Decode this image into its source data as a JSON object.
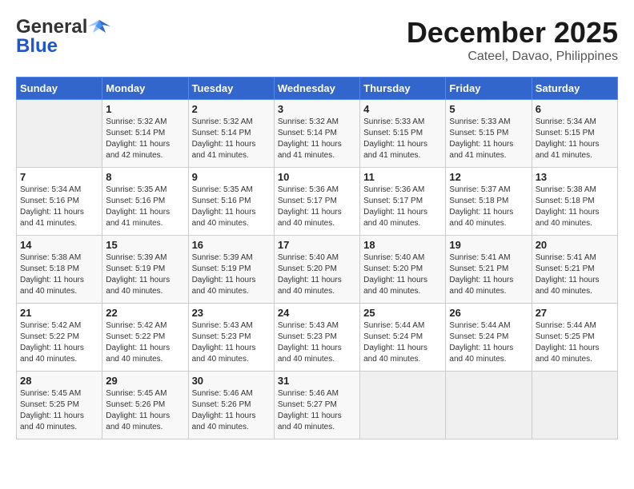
{
  "header": {
    "logo_general": "General",
    "logo_blue": "Blue",
    "month_year": "December 2025",
    "location": "Cateel, Davao, Philippines"
  },
  "weekdays": [
    "Sunday",
    "Monday",
    "Tuesday",
    "Wednesday",
    "Thursday",
    "Friday",
    "Saturday"
  ],
  "weeks": [
    [
      {
        "day": "",
        "sunrise": "",
        "sunset": "",
        "daylight": ""
      },
      {
        "day": "1",
        "sunrise": "Sunrise: 5:32 AM",
        "sunset": "Sunset: 5:14 PM",
        "daylight": "Daylight: 11 hours and 42 minutes."
      },
      {
        "day": "2",
        "sunrise": "Sunrise: 5:32 AM",
        "sunset": "Sunset: 5:14 PM",
        "daylight": "Daylight: 11 hours and 41 minutes."
      },
      {
        "day": "3",
        "sunrise": "Sunrise: 5:32 AM",
        "sunset": "Sunset: 5:14 PM",
        "daylight": "Daylight: 11 hours and 41 minutes."
      },
      {
        "day": "4",
        "sunrise": "Sunrise: 5:33 AM",
        "sunset": "Sunset: 5:15 PM",
        "daylight": "Daylight: 11 hours and 41 minutes."
      },
      {
        "day": "5",
        "sunrise": "Sunrise: 5:33 AM",
        "sunset": "Sunset: 5:15 PM",
        "daylight": "Daylight: 11 hours and 41 minutes."
      },
      {
        "day": "6",
        "sunrise": "Sunrise: 5:34 AM",
        "sunset": "Sunset: 5:15 PM",
        "daylight": "Daylight: 11 hours and 41 minutes."
      }
    ],
    [
      {
        "day": "7",
        "sunrise": "Sunrise: 5:34 AM",
        "sunset": "Sunset: 5:16 PM",
        "daylight": "Daylight: 11 hours and 41 minutes."
      },
      {
        "day": "8",
        "sunrise": "Sunrise: 5:35 AM",
        "sunset": "Sunset: 5:16 PM",
        "daylight": "Daylight: 11 hours and 41 minutes."
      },
      {
        "day": "9",
        "sunrise": "Sunrise: 5:35 AM",
        "sunset": "Sunset: 5:16 PM",
        "daylight": "Daylight: 11 hours and 40 minutes."
      },
      {
        "day": "10",
        "sunrise": "Sunrise: 5:36 AM",
        "sunset": "Sunset: 5:17 PM",
        "daylight": "Daylight: 11 hours and 40 minutes."
      },
      {
        "day": "11",
        "sunrise": "Sunrise: 5:36 AM",
        "sunset": "Sunset: 5:17 PM",
        "daylight": "Daylight: 11 hours and 40 minutes."
      },
      {
        "day": "12",
        "sunrise": "Sunrise: 5:37 AM",
        "sunset": "Sunset: 5:18 PM",
        "daylight": "Daylight: 11 hours and 40 minutes."
      },
      {
        "day": "13",
        "sunrise": "Sunrise: 5:38 AM",
        "sunset": "Sunset: 5:18 PM",
        "daylight": "Daylight: 11 hours and 40 minutes."
      }
    ],
    [
      {
        "day": "14",
        "sunrise": "Sunrise: 5:38 AM",
        "sunset": "Sunset: 5:18 PM",
        "daylight": "Daylight: 11 hours and 40 minutes."
      },
      {
        "day": "15",
        "sunrise": "Sunrise: 5:39 AM",
        "sunset": "Sunset: 5:19 PM",
        "daylight": "Daylight: 11 hours and 40 minutes."
      },
      {
        "day": "16",
        "sunrise": "Sunrise: 5:39 AM",
        "sunset": "Sunset: 5:19 PM",
        "daylight": "Daylight: 11 hours and 40 minutes."
      },
      {
        "day": "17",
        "sunrise": "Sunrise: 5:40 AM",
        "sunset": "Sunset: 5:20 PM",
        "daylight": "Daylight: 11 hours and 40 minutes."
      },
      {
        "day": "18",
        "sunrise": "Sunrise: 5:40 AM",
        "sunset": "Sunset: 5:20 PM",
        "daylight": "Daylight: 11 hours and 40 minutes."
      },
      {
        "day": "19",
        "sunrise": "Sunrise: 5:41 AM",
        "sunset": "Sunset: 5:21 PM",
        "daylight": "Daylight: 11 hours and 40 minutes."
      },
      {
        "day": "20",
        "sunrise": "Sunrise: 5:41 AM",
        "sunset": "Sunset: 5:21 PM",
        "daylight": "Daylight: 11 hours and 40 minutes."
      }
    ],
    [
      {
        "day": "21",
        "sunrise": "Sunrise: 5:42 AM",
        "sunset": "Sunset: 5:22 PM",
        "daylight": "Daylight: 11 hours and 40 minutes."
      },
      {
        "day": "22",
        "sunrise": "Sunrise: 5:42 AM",
        "sunset": "Sunset: 5:22 PM",
        "daylight": "Daylight: 11 hours and 40 minutes."
      },
      {
        "day": "23",
        "sunrise": "Sunrise: 5:43 AM",
        "sunset": "Sunset: 5:23 PM",
        "daylight": "Daylight: 11 hours and 40 minutes."
      },
      {
        "day": "24",
        "sunrise": "Sunrise: 5:43 AM",
        "sunset": "Sunset: 5:23 PM",
        "daylight": "Daylight: 11 hours and 40 minutes."
      },
      {
        "day": "25",
        "sunrise": "Sunrise: 5:44 AM",
        "sunset": "Sunset: 5:24 PM",
        "daylight": "Daylight: 11 hours and 40 minutes."
      },
      {
        "day": "26",
        "sunrise": "Sunrise: 5:44 AM",
        "sunset": "Sunset: 5:24 PM",
        "daylight": "Daylight: 11 hours and 40 minutes."
      },
      {
        "day": "27",
        "sunrise": "Sunrise: 5:44 AM",
        "sunset": "Sunset: 5:25 PM",
        "daylight": "Daylight: 11 hours and 40 minutes."
      }
    ],
    [
      {
        "day": "28",
        "sunrise": "Sunrise: 5:45 AM",
        "sunset": "Sunset: 5:25 PM",
        "daylight": "Daylight: 11 hours and 40 minutes."
      },
      {
        "day": "29",
        "sunrise": "Sunrise: 5:45 AM",
        "sunset": "Sunset: 5:26 PM",
        "daylight": "Daylight: 11 hours and 40 minutes."
      },
      {
        "day": "30",
        "sunrise": "Sunrise: 5:46 AM",
        "sunset": "Sunset: 5:26 PM",
        "daylight": "Daylight: 11 hours and 40 minutes."
      },
      {
        "day": "31",
        "sunrise": "Sunrise: 5:46 AM",
        "sunset": "Sunset: 5:27 PM",
        "daylight": "Daylight: 11 hours and 40 minutes."
      },
      {
        "day": "",
        "sunrise": "",
        "sunset": "",
        "daylight": ""
      },
      {
        "day": "",
        "sunrise": "",
        "sunset": "",
        "daylight": ""
      },
      {
        "day": "",
        "sunrise": "",
        "sunset": "",
        "daylight": ""
      }
    ]
  ]
}
